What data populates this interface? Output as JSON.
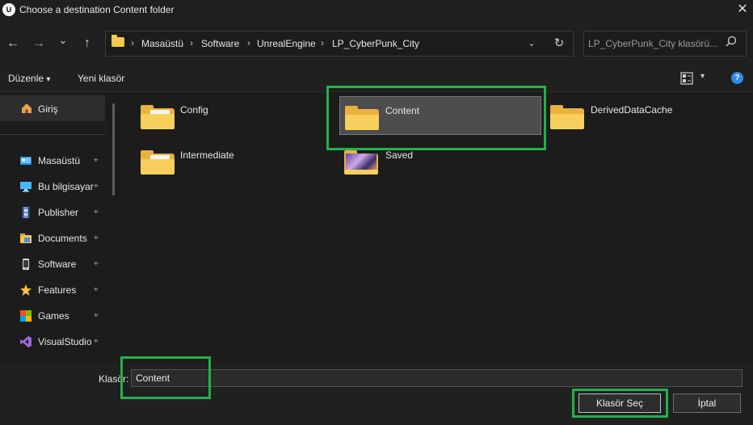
{
  "window": {
    "title": "Choose a destination Content folder",
    "app_icon_text": "U",
    "close_glyph": "✕"
  },
  "nav": {
    "back_glyph": "←",
    "forward_glyph": "→",
    "recent_glyph": "⌄",
    "up_glyph": "↑",
    "breadcrumbs": [
      "Masaüstü",
      "Software",
      "UnrealEngine",
      "LP_CyberPunk_City"
    ],
    "separator": "›",
    "dropdown_glyph": "⌄",
    "refresh_glyph": "↻"
  },
  "search": {
    "placeholder": "LP_CyberPunk_City klasörü...",
    "icon": "search-icon"
  },
  "toolbar": {
    "organize_label": "Düzenle",
    "organize_arrow": "▾",
    "new_folder_label": "Yeni klasör",
    "view_arrow": "▾",
    "help_glyph": "?"
  },
  "sidebar": {
    "home_label": "Giriş",
    "items": [
      {
        "label": "Masaüstü",
        "icon": "desktop-icon"
      },
      {
        "label": "Bu bilgisayar",
        "icon": "computer-icon"
      },
      {
        "label": "Publisher",
        "icon": "film-icon"
      },
      {
        "label": "Documents",
        "icon": "folder-icon"
      },
      {
        "label": "Software",
        "icon": "phone-icon"
      },
      {
        "label": "Features",
        "icon": "star-icon"
      },
      {
        "label": "Games",
        "icon": "games-icon"
      },
      {
        "label": "VisualStudio",
        "icon": "visualstudio-icon"
      }
    ],
    "pin_glyph": "📌"
  },
  "folders": [
    {
      "name": "Config"
    },
    {
      "name": "Content"
    },
    {
      "name": "DerivedDataCache"
    },
    {
      "name": "Intermediate"
    },
    {
      "name": "Saved"
    }
  ],
  "bottom": {
    "folder_label": "Klasör:",
    "folder_value": "Content",
    "select_label": "Klasör Seç",
    "cancel_label": "İptal"
  },
  "colors": {
    "highlight": "#22b14c",
    "accent_blue": "#2f8ceb",
    "folder_yellow": "#f7cf5d"
  }
}
